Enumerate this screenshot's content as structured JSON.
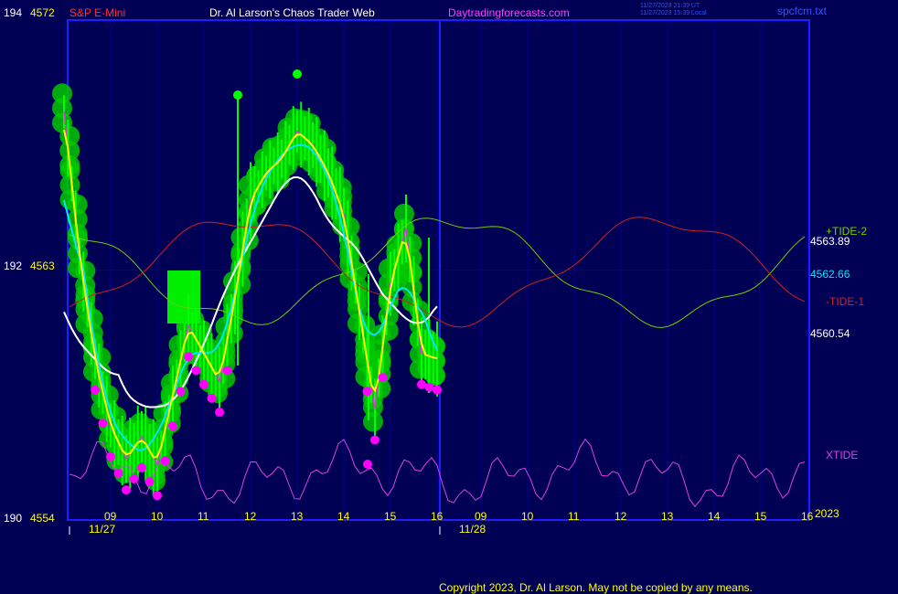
{
  "header": {
    "left_axis_top": "194",
    "price_top": "4572",
    "symbol": "S&P E-Mini",
    "title": "Dr. Al Larson's Chaos Trader Web",
    "site": "Daytradingforecasts.com",
    "stamp_utc": "11/27/2023 21:39 UT",
    "stamp_local": "11/27/2023 15:39 Local",
    "file": "spcfcm.txt"
  },
  "left_axis": [
    {
      "level": "194",
      "price": "4572"
    },
    {
      "level": "192",
      "price": "4563"
    },
    {
      "level": "190",
      "price": "4554"
    }
  ],
  "right_labels": {
    "tide_plus": "+TIDE-2",
    "tide_plus_val": "4563.89",
    "cyan_val": "4562.66",
    "tide_minus": "-TIDE-1",
    "yellow_val": "4560.54",
    "xtide": "XTIDE",
    "year": "2023"
  },
  "x_axis": {
    "hours": [
      "09",
      "10",
      "11",
      "12",
      "13",
      "14",
      "15",
      "16",
      "09",
      "10",
      "11",
      "12",
      "13",
      "14",
      "15",
      "16"
    ],
    "dates": [
      "11/27",
      "11/28"
    ]
  },
  "footer": "Copyright 2023, Dr. Al Larson. May not be copied by any means.",
  "colors": {
    "background": "#000055",
    "grid": "#0000cc",
    "frame": "#0000ff",
    "price_bar": "#00ff00",
    "ball": "#00c800",
    "mean_yellow": "#ffff00",
    "mean_cyan": "#00e5ff",
    "mean_white": "#ffffff",
    "mean_magenta": "#d040d0",
    "tide_plus": "#6fd000",
    "tide_minus": "#d02020",
    "xtide": "#e040e0",
    "extreme_dot": "#ff00ff"
  },
  "chart_data": {
    "type": "line",
    "title": "S&P E-Mini",
    "y_left_range": [
      4554,
      4572
    ],
    "y_left_levels": [
      190,
      194
    ],
    "x": [
      "11/27 08:00",
      "11/27 09:00",
      "11/27 10:00",
      "11/27 11:00",
      "11/27 12:00",
      "11/27 13:00",
      "11/27 14:00",
      "11/27 15:00",
      "11/27 16:00",
      "11/28 09:00",
      "11/28 10:00",
      "11/28 11:00",
      "11/28 12:00",
      "11/28 13:00",
      "11/28 14:00",
      "11/28 15:00",
      "11/28 16:00"
    ],
    "price_x": [
      "11/27 08:00",
      "11/27 08:20",
      "11/27 08:40",
      "11/27 09:00",
      "11/27 09:20",
      "11/27 09:40",
      "11/27 10:00",
      "11/27 10:20",
      "11/27 10:40",
      "11/27 11:00",
      "11/27 11:20",
      "11/27 11:40",
      "11/27 12:00",
      "11/27 12:20",
      "11/27 12:40",
      "11/27 13:00",
      "11/27 13:20",
      "11/27 13:40",
      "11/27 14:00",
      "11/27 14:20",
      "11/27 14:40",
      "11/27 15:00",
      "11/27 15:20",
      "11/27 15:40",
      "11/27 16:00"
    ],
    "price_series": {
      "name": "S&P E-Mini",
      "values": [
        4568.7,
        4563.5,
        4559.8,
        4557.4,
        4556.2,
        4557.0,
        4556.0,
        4558.5,
        4561.0,
        4560.0,
        4559.0,
        4562.0,
        4565.5,
        4566.5,
        4567.0,
        4568.0,
        4567.5,
        4566.5,
        4565.0,
        4561.5,
        4558.0,
        4562.5,
        4564.5,
        4560.0,
        4559.8
      ]
    },
    "series": [
      {
        "name": "+TIDE-2",
        "last": 4563.89
      },
      {
        "name": "-TIDE-1"
      },
      {
        "name": "XTIDE"
      }
    ],
    "labeled_values": [
      4563.89,
      4562.66,
      4560.54
    ],
    "grid": true
  }
}
